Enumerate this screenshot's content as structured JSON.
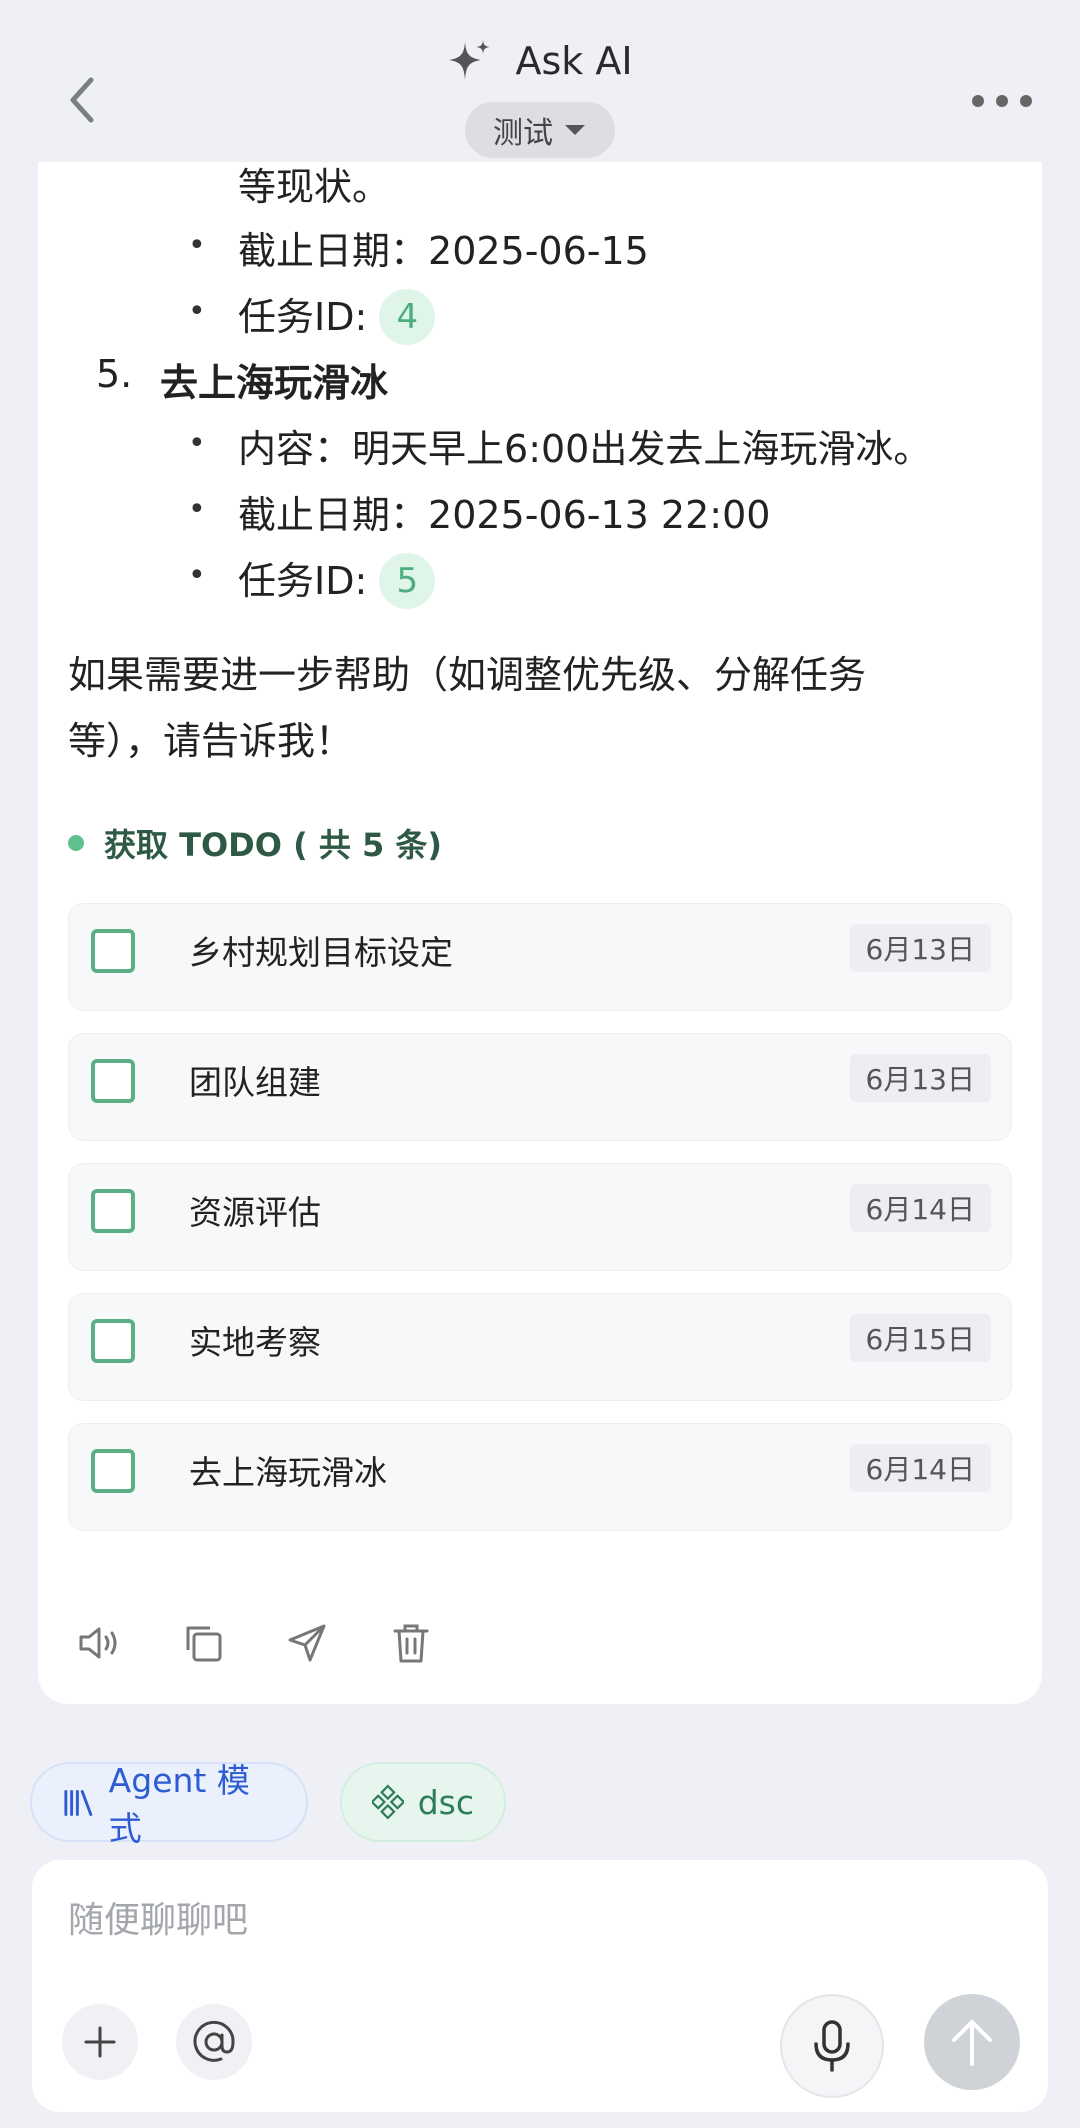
{
  "header": {
    "title": "Ask AI",
    "model": "测试"
  },
  "message": {
    "prev_tail": "等现状。",
    "task4": {
      "due_label": "截止日期：",
      "due_value": "2025-06-15",
      "id_label": "任务ID:",
      "id_value": "4"
    },
    "task5": {
      "number": "5.",
      "title": "去上海玩滑冰",
      "content_label": "内容：",
      "content_value": "明天早上6:00出发去上海玩滑冰。",
      "due_label": "截止日期：",
      "due_value": "2025-06-13 22:00",
      "id_label": "任务ID:",
      "id_value": "5"
    },
    "bullet_char": "•",
    "closing_line1": "如果需要进一步帮助（如调整优先级、分解任务",
    "closing_line2": "等），请告诉我！"
  },
  "tool": {
    "label": "获取 TODO ( 共 5 条)"
  },
  "todos": [
    {
      "text": "乡村规划目标设定",
      "date": "6月13日"
    },
    {
      "text": "团队组建",
      "date": "6月13日"
    },
    {
      "text": "资源评估",
      "date": "6月14日"
    },
    {
      "text": "实地考察",
      "date": "6月15日"
    },
    {
      "text": "去上海玩滑冰",
      "date": "6月14日"
    }
  ],
  "chips": {
    "agent": "Agent 模式",
    "dsc": "dsc"
  },
  "composer": {
    "placeholder": "随便聊聊吧"
  },
  "icons": {
    "back": "chevron-left-icon",
    "sparkle": "sparkle-icon",
    "more": "more-horizontal-icon",
    "speaker": "speaker-icon",
    "copy": "copy-icon",
    "share": "send-icon",
    "delete": "trash-icon",
    "plus": "plus-icon",
    "at": "at-icon",
    "mic": "mic-icon",
    "send": "arrow-up-icon"
  },
  "colors": {
    "accent_green": "#5aaf84",
    "accent_blue": "#2f5bd3",
    "background": "#eef0f5"
  }
}
